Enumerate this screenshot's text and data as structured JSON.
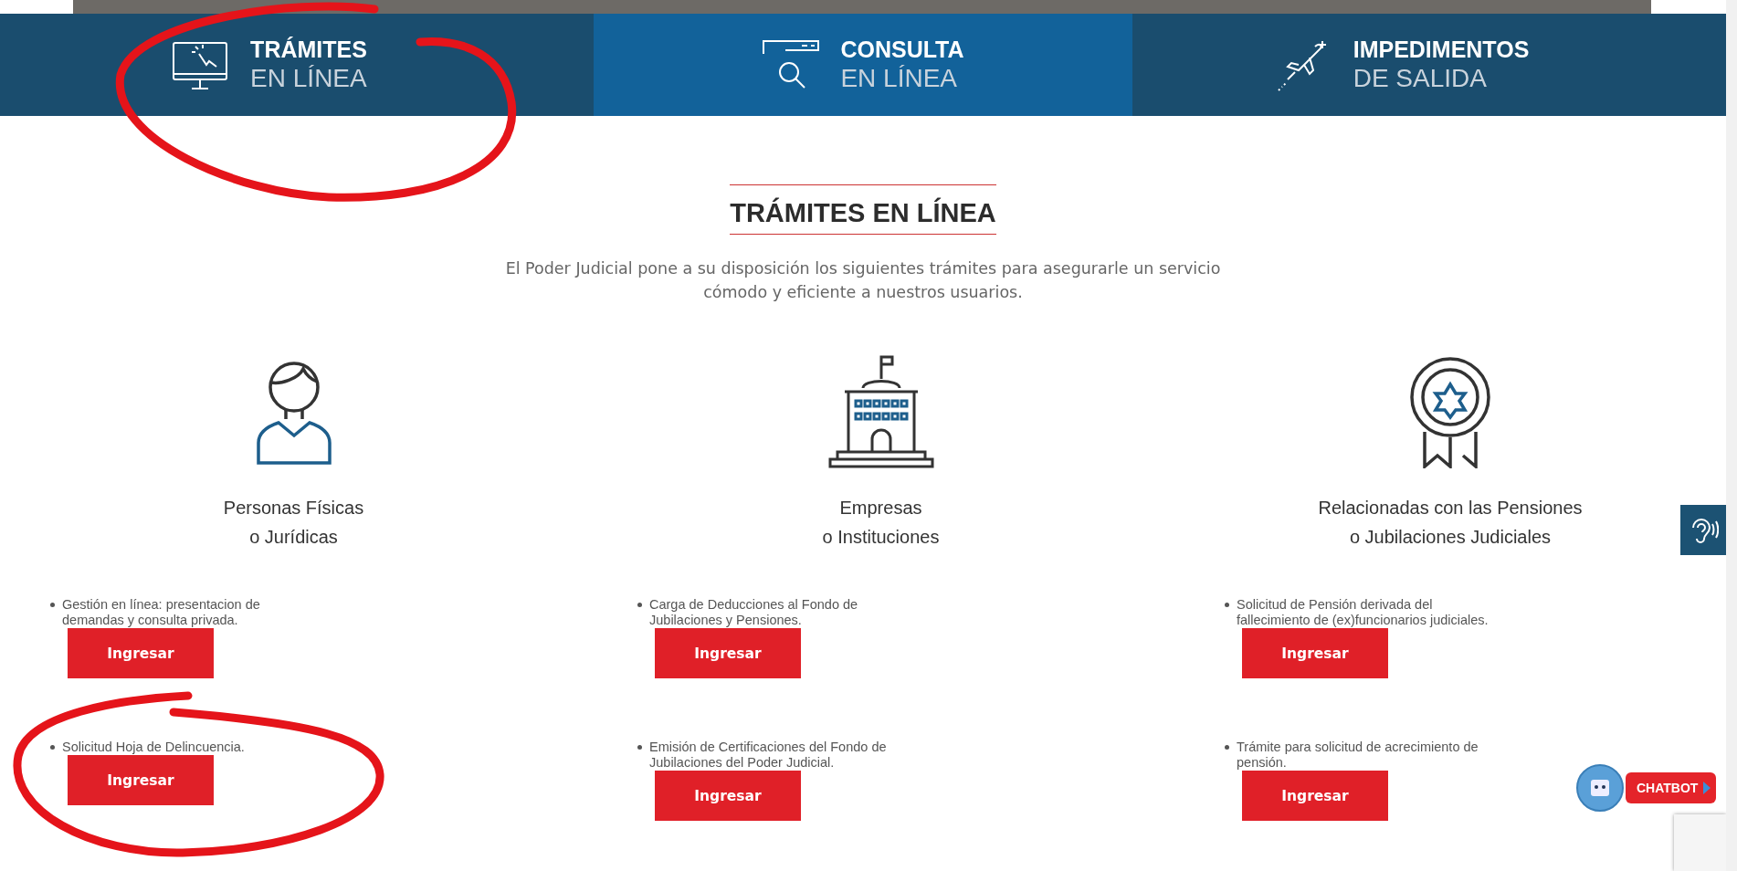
{
  "nav_tabs": [
    {
      "title": "TRÁMITES",
      "subtitle": "EN LÍNEA",
      "kind": "monitor",
      "selected": false
    },
    {
      "title": "CONSULTA",
      "subtitle": "EN LÍNEA",
      "kind": "search",
      "selected": true
    },
    {
      "title": "IMPEDIMENTOS",
      "subtitle": "DE SALIDA",
      "kind": "plane",
      "selected": false
    }
  ],
  "section": {
    "title": "TRÁMITES EN LÍNEA",
    "intro": "El Poder Judicial pone a su disposición los siguientes trámites para asegurarle un servicio cómodo y eficiente a nuestros usuarios."
  },
  "columns": [
    {
      "kind": "person",
      "title_lines": [
        "Personas Físicas",
        "o Jurídicas"
      ],
      "items": [
        {
          "text": "Gestión en línea: presentacion de demandas y consulta privada.",
          "button": "Ingresar"
        },
        {
          "text": "Solicitud Hoja de Delincuencia.",
          "button": "Ingresar"
        }
      ]
    },
    {
      "kind": "building",
      "title_lines": [
        "Empresas",
        "o Instituciones"
      ],
      "items": [
        {
          "text": "Carga de Deducciones al Fondo de Jubilaciones y Pensiones.",
          "button": "Ingresar"
        },
        {
          "text": "Emisión de Certificaciones del Fondo de Jubilaciones del Poder Judicial.",
          "button": "Ingresar"
        }
      ]
    },
    {
      "kind": "medal",
      "title_lines": [
        "Relacionadas con las Pensiones",
        "o Jubilaciones Judiciales"
      ],
      "items": [
        {
          "text": "Solicitud de Pensión derivada del fallecimiento de (ex)funcionarios judiciales.",
          "button": "Ingresar"
        },
        {
          "text": "Trámite para solicitud de acrecimiento de pensión.",
          "button": "Ingresar"
        }
      ]
    }
  ],
  "chatbot": {
    "label": "CHATBOT"
  },
  "annotations": [
    {
      "kind": "circle"
    },
    {
      "kind": "circle"
    }
  ]
}
